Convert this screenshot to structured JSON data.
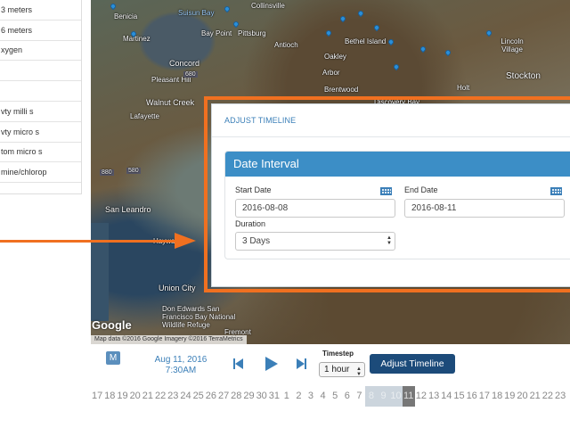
{
  "sidebar": {
    "items": [
      "3 meters",
      "6 meters",
      "xygen",
      "",
      "",
      "vty milli s",
      "vty micro s",
      "tom micro s",
      "mine/chlorop"
    ]
  },
  "map": {
    "cities": [
      "Benicia",
      "Suisun Bay",
      "Collinsville",
      "Martinez",
      "Bay Point",
      "Pittsburg",
      "Antioch",
      "Oakley",
      "Bethel Island",
      "Lincoln Village",
      "Concord",
      "Pleasant Hill",
      "Arbor",
      "Brentwood",
      "Stockton",
      "Walnut Creek",
      "Lafayette",
      "Holt",
      "Discovery Bay",
      "San Leandro",
      "Hayward",
      "Union City",
      "Don Edwards San Francisco Bay National Wildlife Refuge",
      "Fremont"
    ],
    "highways": [
      "680",
      "580",
      "880"
    ],
    "google_logo": "Google",
    "attribution": "Map data ©2016 Google Imagery ©2016 TerraMetrics"
  },
  "panel": {
    "title": "ADJUST TIMELINE",
    "card_title": "Date Interval",
    "start_label": "Start Date",
    "start_value": "2016-08-08",
    "end_label": "End Date",
    "end_value": "2016-08-11",
    "duration_label": "Duration",
    "duration_value": "3 Days"
  },
  "controls": {
    "m_label": "M",
    "date": "Aug 11, 2016",
    "time": "7:30AM",
    "timestep_label": "Timestep",
    "timestep_value": "1 hour",
    "adjust_button": "Adjust Timeline"
  },
  "timeline": {
    "ticks": [
      "17",
      "18",
      "19",
      "20",
      "21",
      "22",
      "23",
      "24",
      "25",
      "26",
      "27",
      "28",
      "29",
      "30",
      "31",
      "1",
      "2",
      "3",
      "4",
      "5",
      "6",
      "7",
      "8",
      "9",
      "10",
      "11",
      "12",
      "13",
      "14",
      "15",
      "16",
      "17",
      "18",
      "19",
      "20",
      "21",
      "22",
      "23"
    ],
    "selected": [
      "8",
      "9",
      "10"
    ],
    "current": "11"
  },
  "colors": {
    "accent": "#3b7fb8",
    "header": "#3c8ec6",
    "button": "#1c4b7a",
    "annotation": "#f07020"
  }
}
